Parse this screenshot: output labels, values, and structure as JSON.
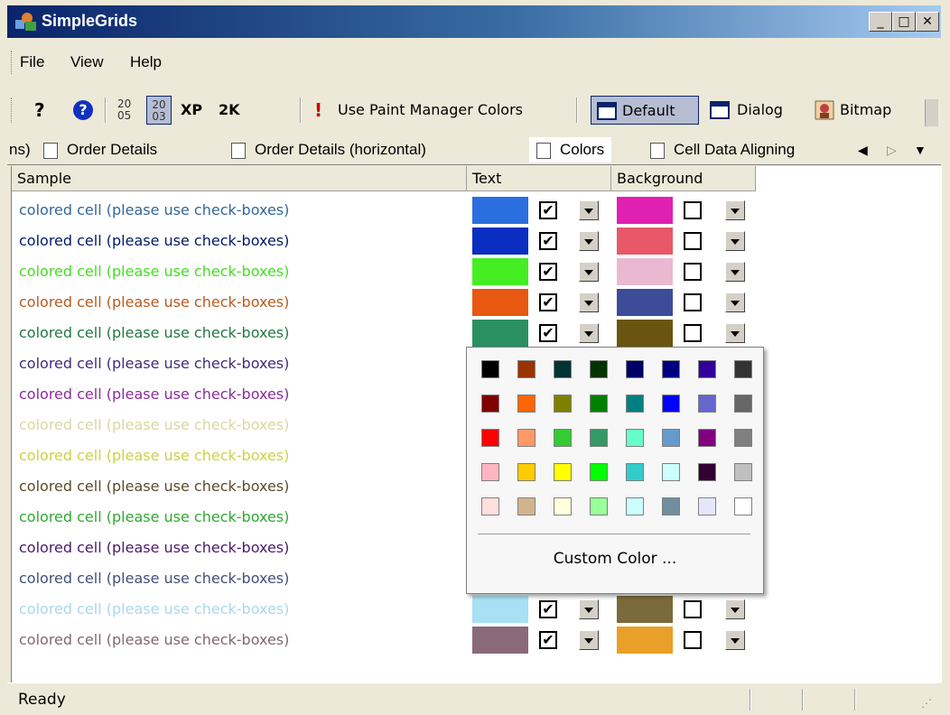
{
  "window": {
    "title": "SimpleGrids"
  },
  "menu": [
    "File",
    "View",
    "Help"
  ],
  "toolbar": {
    "help_glyph": "?",
    "info_glyph": "?",
    "style2005": "20\n05",
    "style2003": "20\n03",
    "xp": "XP",
    "k2": "2K",
    "exclaim": "!",
    "paint_mgr": "Use Paint Manager Colors",
    "default": "Default",
    "dialog": "Dialog",
    "bitmap": "Bitmap"
  },
  "tabs": [
    "ns)",
    "Order Details",
    "Order Details (horizontal)",
    "Colors",
    "Cell Data Aligning"
  ],
  "columns": [
    "Sample",
    "Text",
    "Background"
  ],
  "rows": [
    {
      "label": "colored cell (please use check-boxes)",
      "text_color": "#336699",
      "swatch": "#2a6ee0",
      "bg": "#e020b0"
    },
    {
      "label": "colored cell (please use check-boxes)",
      "text_color": "#001a66",
      "swatch": "#0a2ec0",
      "bg": "#e85868"
    },
    {
      "label": "colored cell (please use check-boxes)",
      "text_color": "#44dd22",
      "swatch": "#44ee22",
      "bg": "#eab8d0"
    },
    {
      "label": "colored cell (please use check-boxes)",
      "text_color": "#b85a1c",
      "swatch": "#e85810",
      "bg": "#3c4c98"
    },
    {
      "label": "colored cell (please use check-boxes)",
      "text_color": "#227744",
      "swatch": "#2a9060",
      "bg": "#6a5410"
    },
    {
      "label": "colored cell (please use check-boxes)",
      "text_color": "#402c7a",
      "swatch": "#4a2c90",
      "bg": "#ffffff"
    },
    {
      "label": "colored cell (please use check-boxes)",
      "text_color": "#8a2c9a",
      "swatch": "#8a2c9a",
      "bg": "#ffffff"
    },
    {
      "label": "colored cell (please use check-boxes)",
      "text_color": "#d8d8a0",
      "swatch": "#d8d8a0",
      "bg": "#ffffff"
    },
    {
      "label": "colored cell (please use check-boxes)",
      "text_color": "#c8d440",
      "swatch": "#c8d440",
      "bg": "#ffffff"
    },
    {
      "label": "colored cell (please use check-boxes)",
      "text_color": "#5a4c2a",
      "swatch": "#5a4c2a",
      "bg": "#ffffff"
    },
    {
      "label": "colored cell (please use check-boxes)",
      "text_color": "#30a830",
      "swatch": "#30a830",
      "bg": "#ffffff"
    },
    {
      "label": "colored cell (please use check-boxes)",
      "text_color": "#4a1a6a",
      "swatch": "#4a1a6a",
      "bg": "#ffffff"
    },
    {
      "label": "colored cell (please use check-boxes)",
      "text_color": "#40507a",
      "swatch": "#40507a",
      "bg": "#ffffff"
    },
    {
      "label": "colored cell (please use check-boxes)",
      "text_color": "#a8d8ec",
      "swatch": "#a8e0f4",
      "bg": "#7a6a3c"
    },
    {
      "label": "colored cell (please use check-boxes)",
      "text_color": "#806870",
      "swatch": "#8a6a78",
      "bg": "#e8a028"
    }
  ],
  "palette": [
    [
      "#000000",
      "#993300",
      "#003333",
      "#003300",
      "#000066",
      "#000080",
      "#330099",
      "#333333"
    ],
    [
      "#800000",
      "#ff6600",
      "#808000",
      "#008000",
      "#008080",
      "#0000ff",
      "#6666cc",
      "#666666"
    ],
    [
      "#ff0000",
      "#ff9966",
      "#33cc33",
      "#339966",
      "#66ffcc",
      "#6699cc",
      "#800080",
      "#808080"
    ],
    [
      "#ffb6c1",
      "#ffcc00",
      "#ffff00",
      "#00ff00",
      "#33cccc",
      "#ccffff",
      "#330033",
      "#c0c0c0"
    ],
    [
      "#ffe0e0",
      "#d2b48c",
      "#ffffe0",
      "#99ff99",
      "#ccffff",
      "#6f8f9f",
      "#e6e6fa",
      "#ffffff"
    ]
  ],
  "custom_color": "Custom Color ...",
  "status": "Ready",
  "checkbox_glyph": "✔"
}
